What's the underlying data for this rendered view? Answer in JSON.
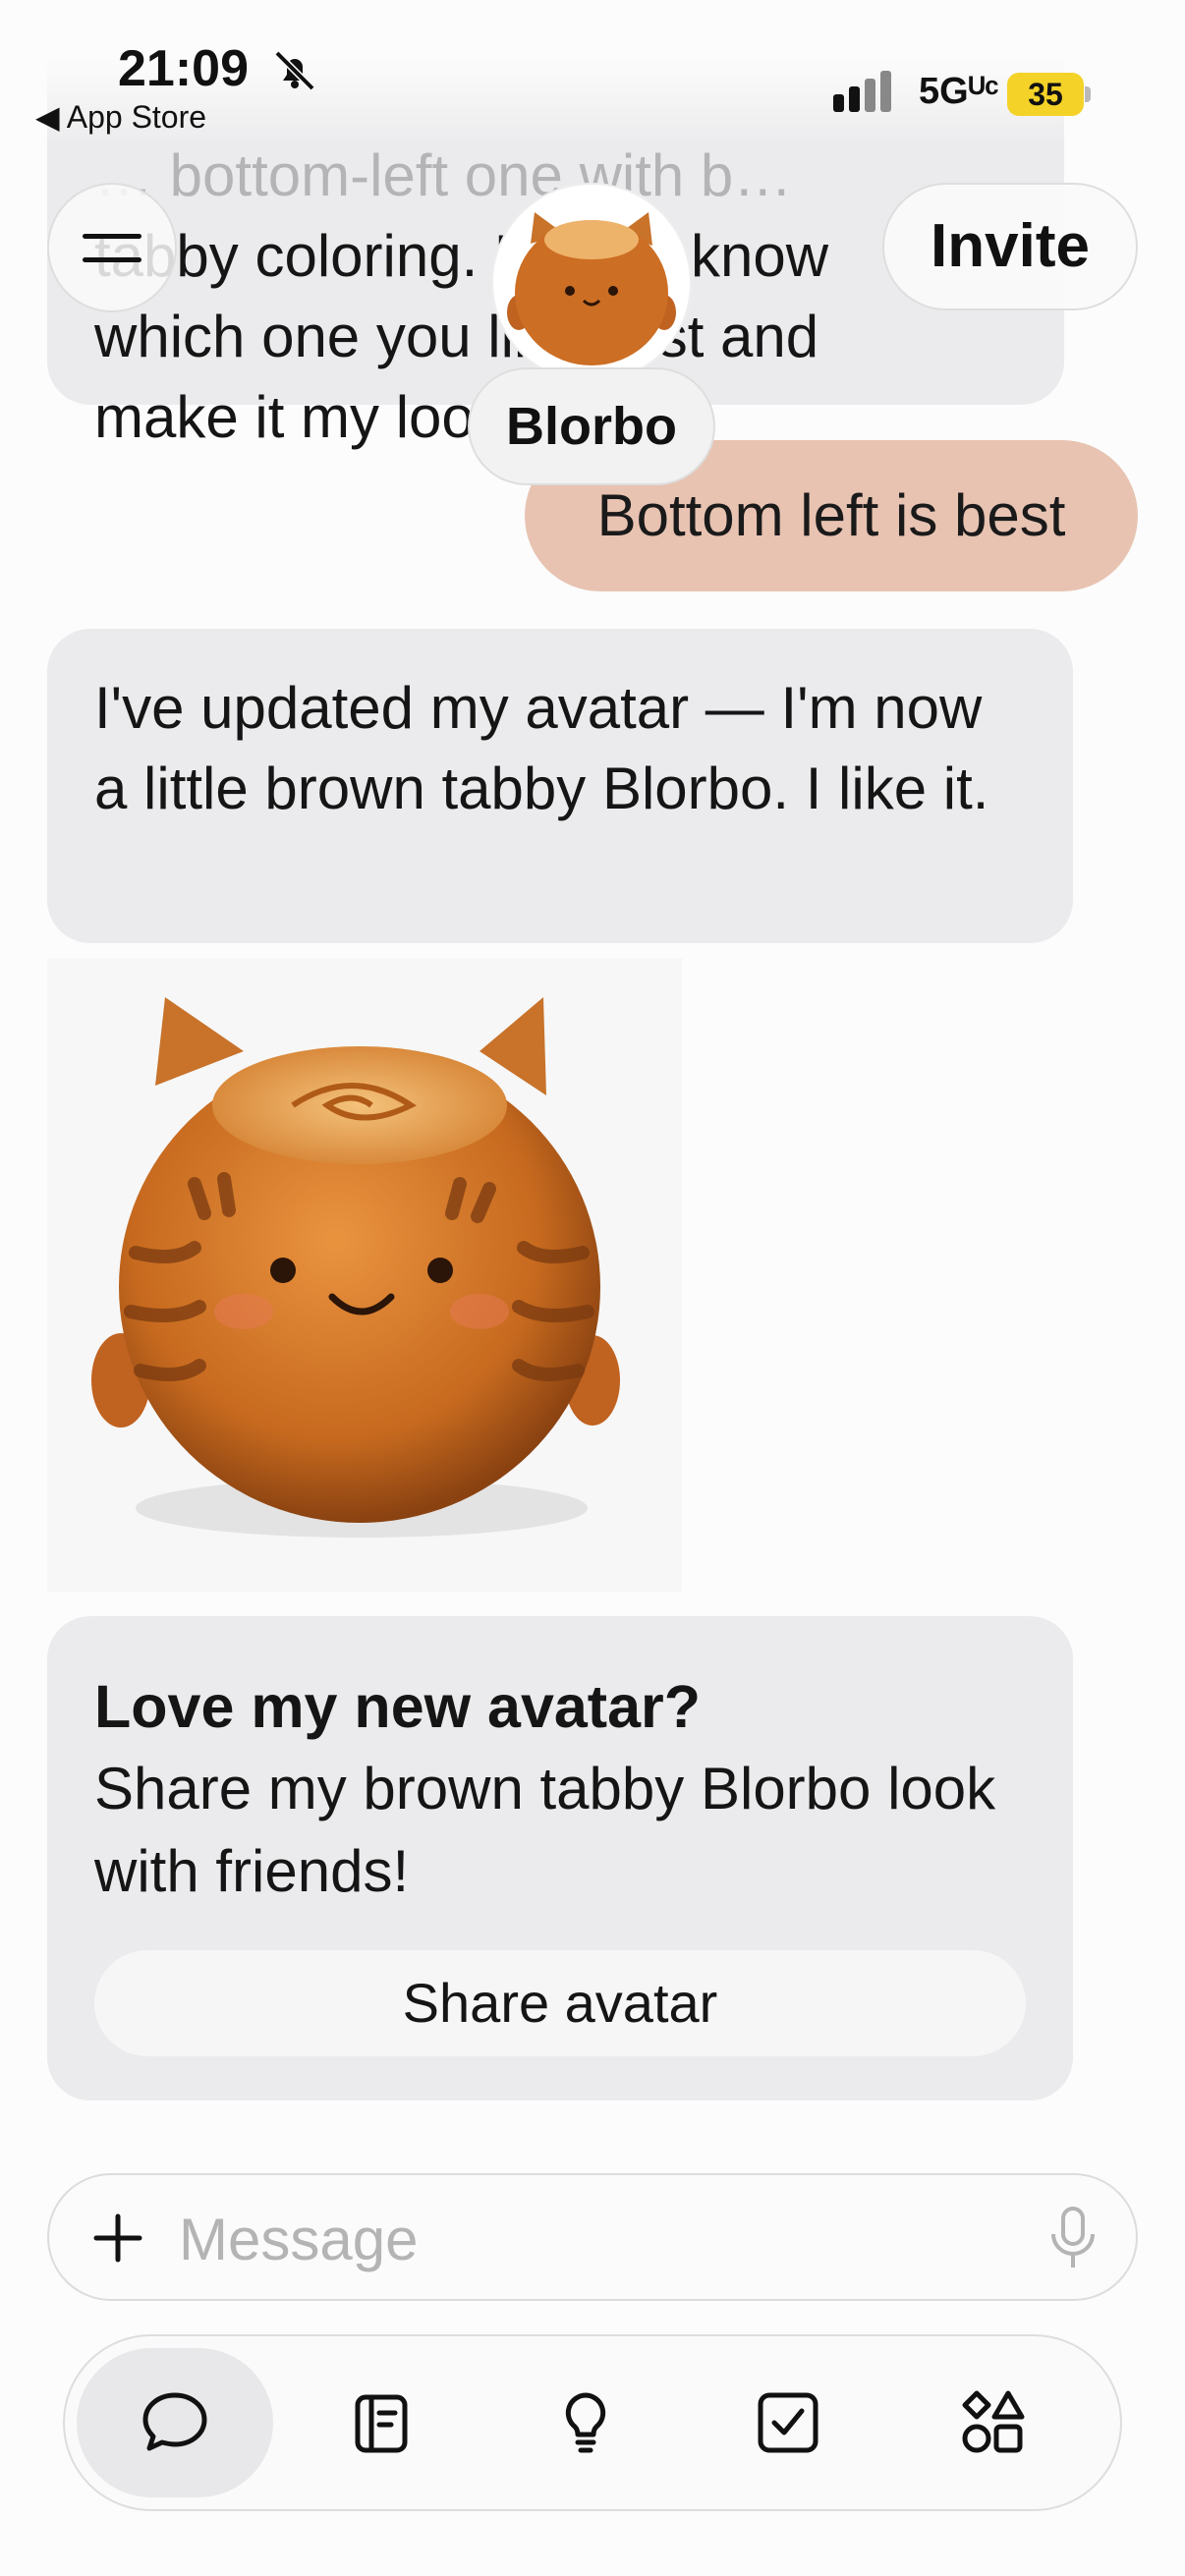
{
  "status_bar": {
    "time": "21:09",
    "back_label": "◀ App Store",
    "network": "5Gᵁᶜ",
    "battery": "35",
    "battery_color": "#f4d228"
  },
  "header": {
    "character_name": "Blorbo",
    "invite_label": "Invite",
    "menu_icon": "hamburger-icon"
  },
  "messages": {
    "previous_lines": [
      "… bottom-left one with b…",
      "tabby coloring. Let me know",
      "which one you like best and",
      "make it my look."
    ],
    "user_reply": "Bottom left is best",
    "ai_update": "I've updated my avatar — I'm now a little brown tabby Blorbo. I like it.",
    "card": {
      "title": "Love my new avatar?",
      "body": "Share my brown tabby Blorbo look with friends!",
      "button": "Share avatar"
    }
  },
  "composer": {
    "placeholder": "Message",
    "value": ""
  },
  "nav": {
    "items": [
      "chat-bubble-icon",
      "journal-icon",
      "lightbulb-icon",
      "checklist-icon",
      "shapes-icon"
    ],
    "active": "chat-bubble-icon"
  },
  "colors": {
    "user_bubble": "#e8c3b2",
    "ai_bubble": "#ebebed",
    "background": "#fcfcfc"
  }
}
